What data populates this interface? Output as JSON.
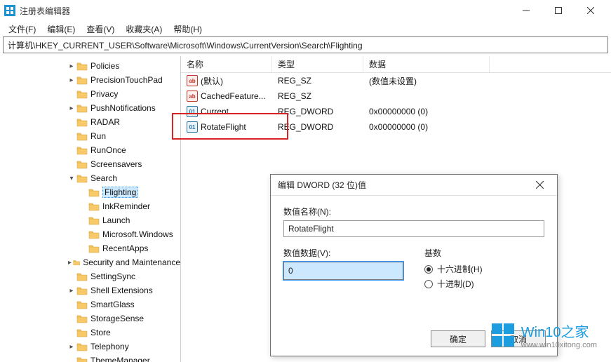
{
  "window": {
    "title": "注册表编辑器"
  },
  "menu": {
    "file": "文件(F)",
    "edit": "编辑(E)",
    "view": "查看(V)",
    "favorites": "收藏夹(A)",
    "help": "帮助(H)"
  },
  "address": "计算机\\HKEY_CURRENT_USER\\Software\\Microsoft\\Windows\\CurrentVersion\\Search\\Flighting",
  "tree": [
    {
      "indent": 95,
      "exp": ">",
      "label": "Policies"
    },
    {
      "indent": 95,
      "exp": ">",
      "label": "PrecisionTouchPad"
    },
    {
      "indent": 95,
      "exp": "",
      "label": "Privacy"
    },
    {
      "indent": 95,
      "exp": ">",
      "label": "PushNotifications"
    },
    {
      "indent": 95,
      "exp": "",
      "label": "RADAR"
    },
    {
      "indent": 95,
      "exp": "",
      "label": "Run"
    },
    {
      "indent": 95,
      "exp": "",
      "label": "RunOnce"
    },
    {
      "indent": 95,
      "exp": "",
      "label": "Screensavers"
    },
    {
      "indent": 95,
      "exp": "v",
      "label": "Search"
    },
    {
      "indent": 112,
      "exp": "",
      "label": "Flighting",
      "selected": true
    },
    {
      "indent": 112,
      "exp": "",
      "label": "InkReminder"
    },
    {
      "indent": 112,
      "exp": "",
      "label": "Launch"
    },
    {
      "indent": 112,
      "exp": "",
      "label": "Microsoft.Windows"
    },
    {
      "indent": 112,
      "exp": "",
      "label": "RecentApps"
    },
    {
      "indent": 95,
      "exp": ">",
      "label": "Security and Maintenance"
    },
    {
      "indent": 95,
      "exp": "",
      "label": "SettingSync"
    },
    {
      "indent": 95,
      "exp": ">",
      "label": "Shell Extensions"
    },
    {
      "indent": 95,
      "exp": "",
      "label": "SmartGlass"
    },
    {
      "indent": 95,
      "exp": "",
      "label": "StorageSense"
    },
    {
      "indent": 95,
      "exp": "",
      "label": "Store"
    },
    {
      "indent": 95,
      "exp": ">",
      "label": "Telephony"
    },
    {
      "indent": 95,
      "exp": "",
      "label": "ThemeManager"
    }
  ],
  "list": {
    "headers": {
      "name": "名称",
      "type": "类型",
      "data": "数据"
    },
    "rows": [
      {
        "icon": "str",
        "name": "(默认)",
        "type": "REG_SZ",
        "data": "(数值未设置)"
      },
      {
        "icon": "str",
        "name": "CachedFeature...",
        "type": "REG_SZ",
        "data": ""
      },
      {
        "icon": "dw",
        "name": "Current",
        "type": "REG_DWORD",
        "data": "0x00000000 (0)"
      },
      {
        "icon": "dw",
        "name": "RotateFlight",
        "type": "REG_DWORD",
        "data": "0x00000000 (0)"
      }
    ]
  },
  "dialog": {
    "title": "编辑 DWORD (32 位)值",
    "name_label": "数值名称(N):",
    "name_value": "RotateFlight",
    "data_label": "数值数据(V):",
    "data_value": "0",
    "base_label": "基数",
    "radio_hex": "十六进制(H)",
    "radio_dec": "十进制(D)",
    "ok": "确定",
    "cancel": "取消"
  },
  "watermark": {
    "line1": "Win10之家",
    "line2": "www.win10xitong.com"
  }
}
